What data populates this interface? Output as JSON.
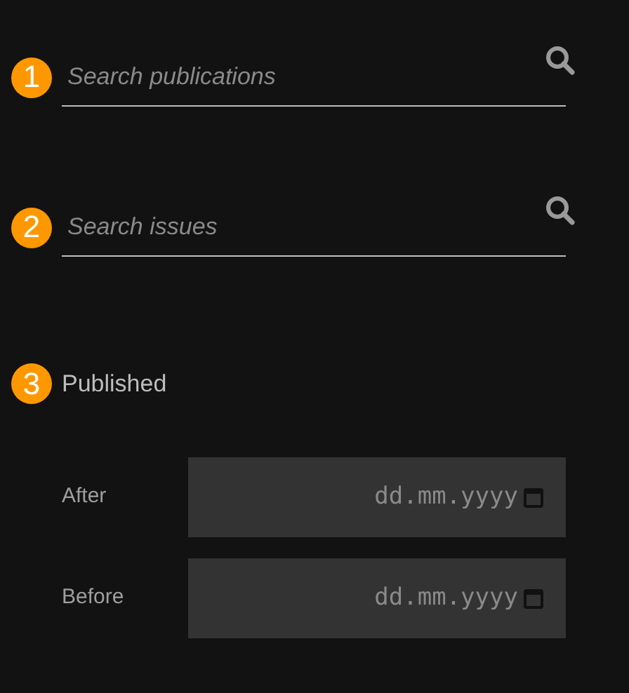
{
  "searches": [
    {
      "step": "1",
      "placeholder": "Search publications"
    },
    {
      "step": "2",
      "placeholder": "Search issues"
    }
  ],
  "published": {
    "step": "3",
    "title": "Published",
    "dates": [
      {
        "label": "After",
        "placeholder": "dd.mm.yyyy"
      },
      {
        "label": "Before",
        "placeholder": "dd.mm.yyyy"
      }
    ]
  }
}
